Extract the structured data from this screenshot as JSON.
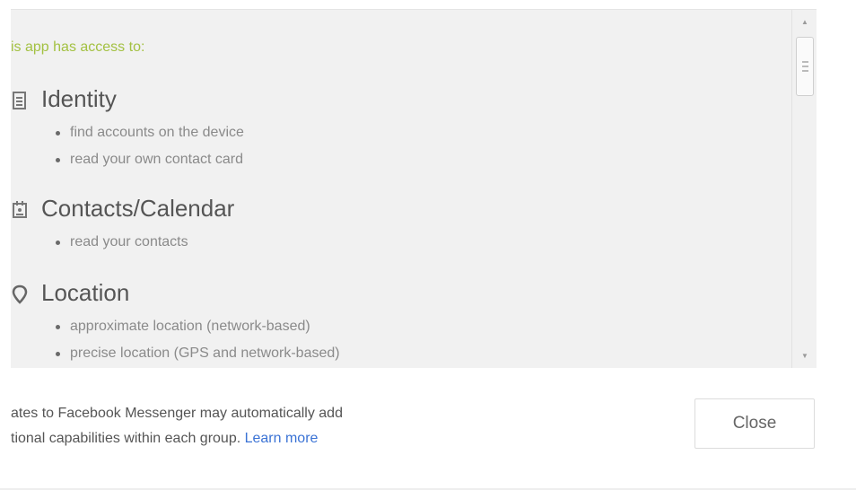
{
  "permissions_panel": {
    "heading": "is app has access to:",
    "groups": [
      {
        "title": "Identity",
        "icon": "identity-card-icon",
        "items": [
          "find accounts on the device",
          "read your own contact card"
        ]
      },
      {
        "title": "Contacts/Calendar",
        "icon": "contacts-calendar-icon",
        "items": [
          "read your contacts"
        ]
      },
      {
        "title": "Location",
        "icon": "location-pin-icon",
        "items": [
          "approximate location (network-based)",
          "precise location (GPS and network-based)"
        ]
      }
    ]
  },
  "footer": {
    "note_line1": "ates to Facebook Messenger may automatically add",
    "note_line2": "tional capabilities within each group.",
    "learn_more": "Learn more",
    "close_label": "Close"
  },
  "colors": {
    "heading_green": "#a3c142",
    "link_blue": "#3b73d5",
    "panel_bg": "#f1f1f1"
  }
}
